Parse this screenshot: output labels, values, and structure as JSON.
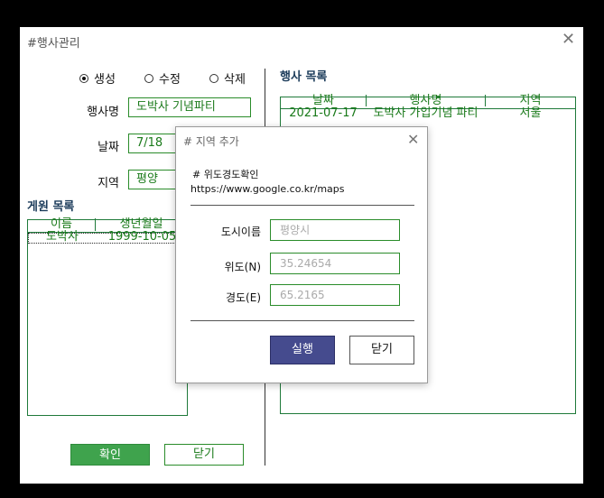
{
  "window": {
    "title": "#행사관리"
  },
  "mode": {
    "options": [
      {
        "label": "생성",
        "checked": true
      },
      {
        "label": "수정",
        "checked": false
      },
      {
        "label": "삭제",
        "checked": false
      }
    ]
  },
  "form": {
    "event_name_label": "행사명",
    "event_name_value": "도박사 기념파티",
    "date_label": "날짜",
    "date_value": "7/18",
    "region_label": "지역",
    "region_value": "평양"
  },
  "members": {
    "title": "게원 목록",
    "headers": [
      "이름",
      "생년월일"
    ],
    "rows": [
      [
        "도박사",
        "1999-10-05"
      ]
    ]
  },
  "events": {
    "title": "행사 목록",
    "headers": [
      "날짜",
      "행사명",
      "지역"
    ],
    "rows": [
      [
        "2021-07-17",
        "도박사 가입기념 파티",
        "서울"
      ]
    ]
  },
  "footer": {
    "confirm_label": "확인",
    "close_label": "닫기"
  },
  "dialog": {
    "title": "# 지역 추가",
    "note_title": "#  위도경도확인",
    "note_url": "https://www.google.co.kr/maps",
    "city_label": "도시이름",
    "city_placeholder": "평양시",
    "lat_label": "위도(N)",
    "lat_placeholder": "35.24654",
    "lon_label": "경도(E)",
    "lon_placeholder": "65.2165",
    "run_label": "실행",
    "close_label": "닫기"
  },
  "colors": {
    "accent_green": "#3fa34d",
    "run_button": "#454b8e",
    "border_green": "#2a8c2a"
  }
}
